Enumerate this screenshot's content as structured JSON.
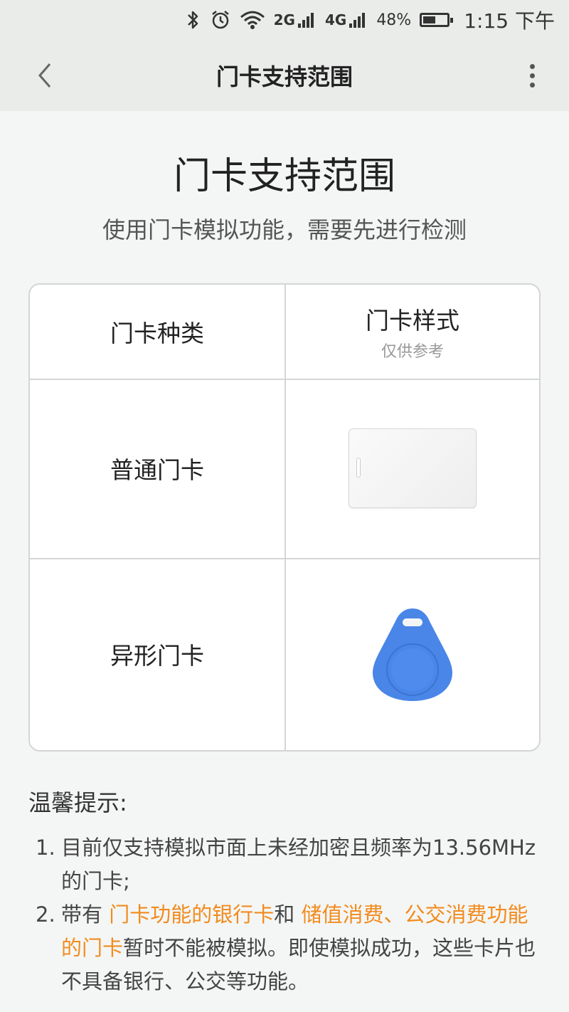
{
  "status_bar": {
    "bluetooth_icon": "bluetooth-icon",
    "alarm_icon": "alarm-icon",
    "wifi_icon": "wifi-icon",
    "network1": "2G",
    "network2": "4G",
    "battery_percent": "48%",
    "battery_level": 0.48,
    "time": "1:15 下午"
  },
  "nav": {
    "title": "门卡支持范围",
    "back_icon": "chevron-left-icon",
    "more_icon": "more-vertical-icon"
  },
  "main": {
    "heading": "门卡支持范围",
    "subheading": "使用门卡模拟功能，需要先进行检测"
  },
  "table": {
    "header_type": "门卡种类",
    "header_style": "门卡样式",
    "header_style_note": "仅供参考",
    "rows": [
      {
        "label": "普通门卡",
        "image": "white-card-image"
      },
      {
        "label": "异形门卡",
        "image": "blue-keyfob-image"
      }
    ]
  },
  "tips": {
    "title": "温馨提示:",
    "item1_num": "1.",
    "item1_text": "目前仅支持模拟市面上未经加密且频率为13.56MHz的门卡;",
    "item2_num": "2.",
    "item2_pre": "带有 ",
    "item2_hl1": "门卡功能的银行卡",
    "item2_mid": "和 ",
    "item2_hl2": "储值消费、公交消费功能的门卡",
    "item2_post": "暂时不能被模拟。即使模拟成功，这些卡片也不具备银行、公交等功能。"
  },
  "colors": {
    "highlight": "#f28b1e",
    "keyfob": "#4a86e8",
    "background": "#f4f6f5"
  }
}
